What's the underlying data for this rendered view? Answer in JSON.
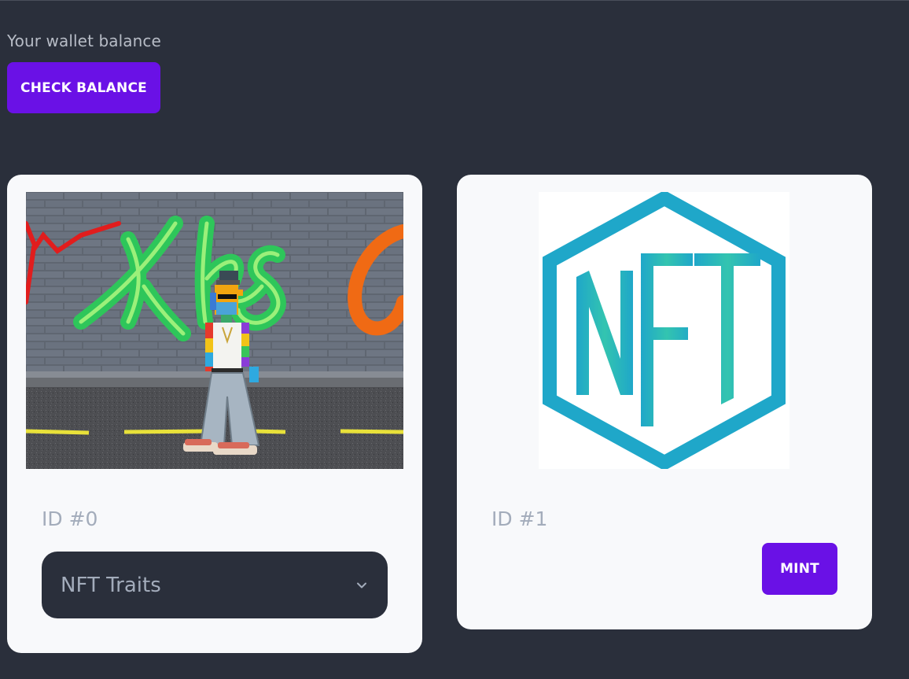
{
  "wallet": {
    "label": "Your wallet balance",
    "check_button": "CHECK BALANCE"
  },
  "cards": [
    {
      "id_label": "ID #0",
      "image_icon": "pixel-art-graffiti-character-image",
      "traits_label": "NFT Traits"
    },
    {
      "id_label": "ID #1",
      "image_icon": "nft-hexagon-logo-image",
      "mint_label": "MINT"
    }
  ],
  "colors": {
    "page_bg": "#2a2f3b",
    "card_bg": "#f8f9fb",
    "accent": "#6a11e6",
    "muted_text": "#a3acbb",
    "nft_logo": "#1fa7c9"
  }
}
